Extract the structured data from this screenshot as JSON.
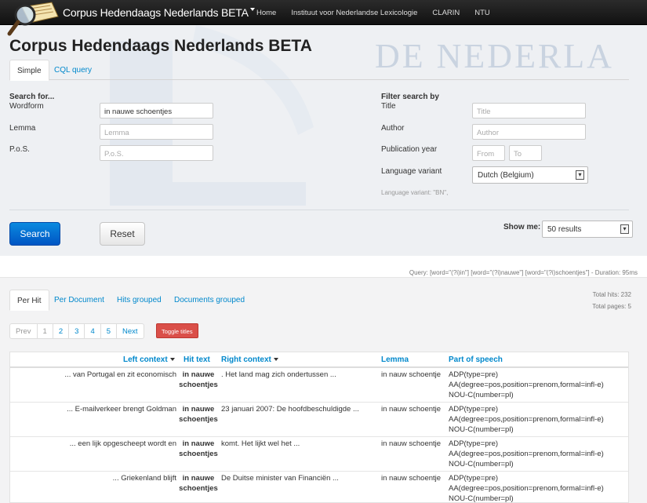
{
  "navbar": {
    "brand": "Corpus Hedendaags Nederlands BETA",
    "links": [
      "Home",
      "Instituut voor Nederlandse Lexicologie",
      "CLARIN",
      "NTU"
    ]
  },
  "header": {
    "title": "Corpus Hedendaags Nederlands BETA",
    "watermark": "DE NEDERLA",
    "tabs": [
      "Simple",
      "CQL query"
    ]
  },
  "search": {
    "heading": "Search for...",
    "wordform_label": "Wordform",
    "wordform_value": "in nauwe schoentjes",
    "lemma_label": "Lemma",
    "lemma_placeholder": "Lemma",
    "pos_label": "P.o.S.",
    "pos_placeholder": "P.o.S."
  },
  "filter": {
    "heading": "Filter search by",
    "title_label": "Title",
    "title_placeholder": "Title",
    "author_label": "Author",
    "author_placeholder": "Author",
    "year_label": "Publication year",
    "from_placeholder": "From",
    "to_placeholder": "To",
    "variant_label": "Language variant",
    "variant_value": "Dutch (Belgium)",
    "variant_hint": "Language variant: \"BN\","
  },
  "actions": {
    "search_label": "Search",
    "reset_label": "Reset",
    "show_me_label": "Show me:",
    "show_me_value": "50 results"
  },
  "query_info": "Query: [word=\"(?i)in\"] [word=\"(?i)nauwe\"] [word=\"(?i)schoentjes\"] - Duration: 95ms",
  "results": {
    "tabs": [
      "Per Hit",
      "Per Document",
      "Hits grouped",
      "Documents grouped"
    ],
    "total_hits": "Total hits: 232",
    "total_pages": "Total pages: 5",
    "pager": [
      "Prev",
      "1",
      "2",
      "3",
      "4",
      "5",
      "Next"
    ],
    "toggle_titles": "Toggle titles",
    "columns": {
      "left": "Left context",
      "hit": "Hit text",
      "right": "Right context",
      "lemma": "Lemma",
      "pos": "Part of speech"
    },
    "rows": [
      {
        "left": "... van Portugal en zit economisch",
        "hit1": "in nauwe",
        "hit2": "schoentjes",
        "right": ". Het land mag zich ondertussen ...",
        "lemma": "in nauw schoentje",
        "pos1": "ADP(type=pre)",
        "pos2": "AA(degree=pos,position=prenom,formal=infl-e)",
        "pos3": "NOU-C(number=pl)"
      },
      {
        "left": "... E-mailverkeer brengt Goldman",
        "hit1": "in nauwe",
        "hit2": "schoentjes",
        "right": "23 januari 2007: De hoofdbeschuldigde ...",
        "lemma": "in nauw schoentje",
        "pos1": "ADP(type=pre)",
        "pos2": "AA(degree=pos,position=prenom,formal=infl-e)",
        "pos3": "NOU-C(number=pl)"
      },
      {
        "left": "... een lijk opgescheept wordt en",
        "hit1": "in nauwe",
        "hit2": "schoentjes",
        "right": "komt. Het lijkt wel het ...",
        "lemma": "in nauw schoentje",
        "pos1": "ADP(type=pre)",
        "pos2": "AA(degree=pos,position=prenom,formal=infl-e)",
        "pos3": "NOU-C(number=pl)"
      },
      {
        "left": "... Griekenland blijft",
        "hit1": "in nauwe",
        "hit2": "schoentjes",
        "right": "De Duitse minister van Financiën ...",
        "lemma": "in nauw schoentje",
        "pos1": "ADP(type=pre)",
        "pos2": "AA(degree=pos,position=prenom,formal=infl-e)",
        "pos3": "NOU-C(number=pl)"
      }
    ]
  }
}
